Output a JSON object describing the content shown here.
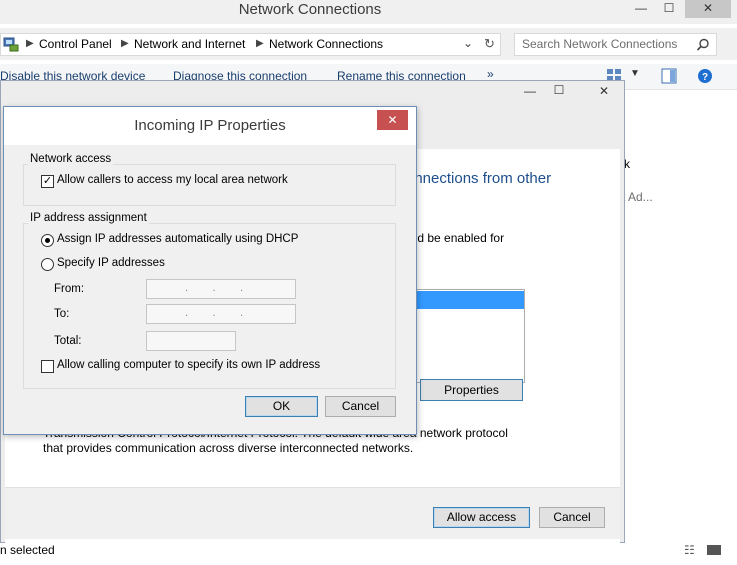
{
  "window": {
    "title": "Network Connections",
    "minimize": "—",
    "maximize": "☐",
    "close": "✕"
  },
  "address": {
    "crumbs": [
      "Control Panel",
      "Network and Internet",
      "Network Connections"
    ],
    "search_placeholder": "Search Network Connections"
  },
  "commands": [
    "Disable this network device",
    "Diagnose this connection",
    "Rename this connection",
    "»"
  ],
  "background": {
    "heading_fragment": "onnections from other",
    "text_fragment": "uld be enabled for",
    "right_fragment_1": "k",
    "right_fragment_2": "t Ad...",
    "properties_button": "Properties",
    "description_line1": "Transmission Control Protocol/Internet Protocol. The default wide area network protocol",
    "description_line2": "that provides communication across diverse interconnected networks.",
    "allow_access_button": "Allow access",
    "cancel_button": "Cancel"
  },
  "status": {
    "text": "n selected"
  },
  "dialog": {
    "title": "Incoming IP Properties",
    "close": "✕",
    "network_access": {
      "label": "Network access",
      "checkbox_label": "Allow callers to access my local area network",
      "checked": true
    },
    "ip_assignment": {
      "label": "IP address assignment",
      "option_dhcp": "Assign IP addresses automatically using DHCP",
      "option_specify": "Specify IP addresses",
      "selected": "dhcp",
      "from_label": "From:",
      "to_label": "To:",
      "total_label": "Total:",
      "from_value": ".        .        .",
      "to_value": ".        .        .",
      "total_value": "",
      "allow_specify_label": "Allow calling computer to specify its own IP address",
      "allow_specify_checked": false
    },
    "ok_button": "OK",
    "cancel_button": "Cancel"
  }
}
